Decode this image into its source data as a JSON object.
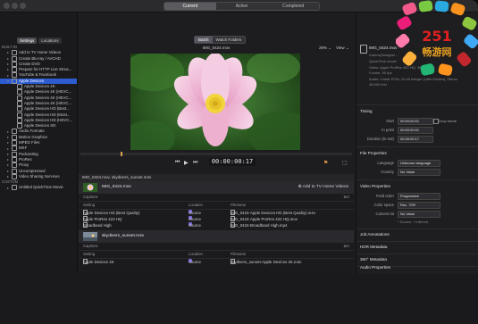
{
  "topbar": {
    "tabs": [
      "Current",
      "Active",
      "Completed"
    ],
    "active_tab": 0
  },
  "sidebar": {
    "tabs": [
      "Settings",
      "Locations"
    ],
    "items": [
      {
        "label": "BUILT-IN",
        "level": 0,
        "type": "header"
      },
      {
        "label": "Add to TV Home Videos",
        "level": 1
      },
      {
        "label": "Create Blu-ray / AVCHD",
        "level": 1
      },
      {
        "label": "Create DVD",
        "level": 1
      },
      {
        "label": "Prepare for HTTP Live Strea...",
        "level": 1
      },
      {
        "label": "YouTube & Facebook",
        "level": 1
      },
      {
        "label": "Apple Devices",
        "level": 1,
        "selected": true
      },
      {
        "label": "Apple Devices 4K",
        "level": 2
      },
      {
        "label": "Apple Devices 4K (HEVC...",
        "level": 2
      },
      {
        "label": "Apple Devices 4K (HEVC...",
        "level": 2
      },
      {
        "label": "Apple Devices 4K (HEVC...",
        "level": 2
      },
      {
        "label": "Apple Devices HD (Best...",
        "level": 2
      },
      {
        "label": "Apple Devices HD (Most...",
        "level": 2
      },
      {
        "label": "Apple Devices HD (HEVC...",
        "level": 2
      },
      {
        "label": "Apple Devices SD",
        "level": 2
      },
      {
        "label": "Audio Formats",
        "level": 1
      },
      {
        "label": "Motion Graphics",
        "level": 1
      },
      {
        "label": "MPEG Files",
        "level": 1
      },
      {
        "label": "MXF",
        "level": 1
      },
      {
        "label": "Podcasting",
        "level": 1
      },
      {
        "label": "ProRes",
        "level": 1
      },
      {
        "label": "Proxy",
        "level": 1
      },
      {
        "label": "Uncompressed",
        "level": 1
      },
      {
        "label": "Video Sharing Services",
        "level": 1
      },
      {
        "label": "CUSTOM",
        "level": 0,
        "type": "header"
      },
      {
        "label": "Untitled QuickTime Movie",
        "level": 1
      }
    ]
  },
  "preview": {
    "batch_tabs": [
      "Batch",
      "Watch Folders"
    ],
    "file_title": "IMG_0424.mov",
    "zoom": "29%",
    "view_label": "View",
    "timecode": "00:00:00:17"
  },
  "joblist": {
    "batch_title": "IMG_0424.mov, skydivers_sunset.m4v",
    "jobs": [
      {
        "name": "IMG_0424.mov",
        "add_label": "Add to TV Home Videos",
        "captions_label": "Captions",
        "set_label": "Set",
        "columns": [
          "Setting",
          "Location",
          "Filename"
        ],
        "rows": [
          {
            "setting": "Apple Devices HD (Best Quality)",
            "location": "Source",
            "filename": "IMG_0424-Apple Devices HD (Best Quality).m4v"
          },
          {
            "setting": "Apple ProRes 422 HQ",
            "location": "Source",
            "filename": "IMG_0424-Apple ProRes 422 HQ.mov"
          },
          {
            "setting": "Broadband High",
            "location": "Source",
            "filename": "IMG_0424-Broadband High.mp4"
          }
        ]
      },
      {
        "name": "skydivers_sunset.m4v",
        "add_label": "",
        "captions_label": "Captions",
        "set_label": "Set",
        "columns": [
          "Setting",
          "Location",
          "Filename"
        ],
        "rows": [
          {
            "setting": "Apple Devices 4K",
            "location": "Source",
            "filename": "skydivers_sunset-Apple Devices 4K.m4v"
          }
        ]
      }
    ]
  },
  "inspector": {
    "filename": "IMG_0424.mov",
    "path": "/Users/j/Images/...",
    "kind": "QuickTime movie",
    "video_line1": "Video: Apple ProRes 422 HQ, 3840x2160",
    "video_line2": "Fourier, 50 fps",
    "audio_line1": "Audio: Linear PCM, 24-bit Integer (Little Endian), Stereo",
    "audio_line2": "48.000 kHz",
    "timing_head": "Timing",
    "start_label": "Start",
    "start_value": "00:00:00:01",
    "drop_frame": "Drop frame",
    "inpoint_label": "In point",
    "inpoint_value": "00:00:00:01",
    "duration_label": "Duration (in-out)",
    "duration_value": "00:00:00:17",
    "file_props_head": "File Properties",
    "language_label": "Language",
    "language_value": "Unknown language",
    "country_label": "Country",
    "country_value": "No Value",
    "video_props_head": "Video Properties",
    "field_order_label": "Field order",
    "field_order_value": "Progressive",
    "color_space_label": "Color space",
    "color_space_value": "Rec. 709*",
    "camera_lut_label": "Camera lut",
    "camera_lut_value": "No Value",
    "inferred_note": "* Source, * Inferred",
    "job_annotations": "Job Annotations",
    "hdr_metadata": "HDR Metadata",
    "360_metadata": "360° Metadata",
    "audio_props_head": "Audio Properties"
  },
  "logo": {
    "text": "251",
    "subtext": "畅游网"
  },
  "colors": {
    "selection": "#2d5bd0",
    "accent": "#7a6bd5",
    "window_bg": "#1d1d1f",
    "leaves": "#2d5e24",
    "petal": "#f2c4de"
  }
}
